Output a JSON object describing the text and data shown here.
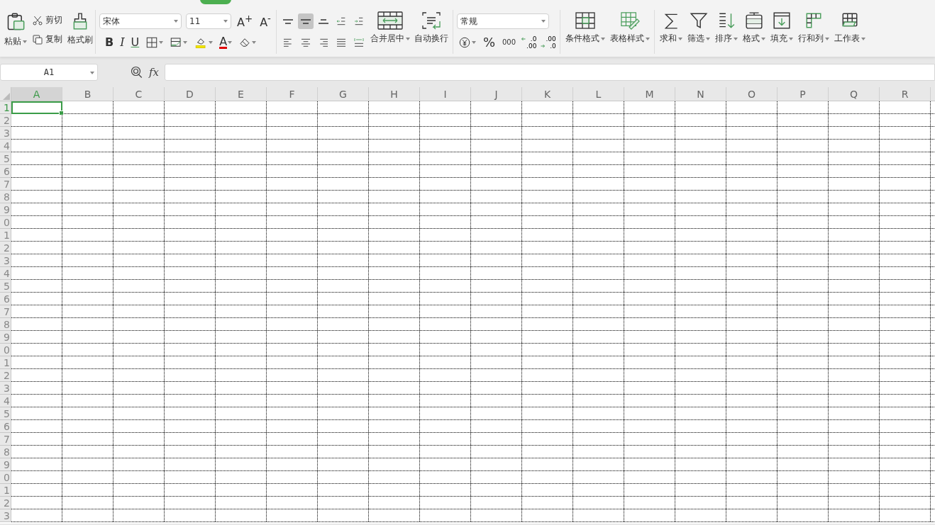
{
  "ribbon": {
    "groups": [
      {
        "kind": "clipboard",
        "paste": "粘贴",
        "cut": "剪切",
        "copy": "复制",
        "painter": "格式刷"
      },
      {
        "kind": "font",
        "font_name": "宋体",
        "font_size": "11",
        "grow": "A$^{+}$",
        "shrink": "A$^{-}$",
        "bold": "B",
        "italic": "I",
        "underline": "U",
        "font_color": "A"
      },
      {
        "kind": "alignment",
        "align_buttons": [
          {
            "selected": false
          },
          {
            "selected": true
          },
          {
            "selected": false
          },
          {
            "selected": false
          },
          {
            "selected": false
          },
          {
            "selected": false
          },
          {
            "selected": false
          },
          {
            "selected": false
          },
          {
            "selected": false
          },
          {
            "selected": false
          }
        ],
        "merge": "合并居中",
        "wrap": "自动换行"
      },
      {
        "kind": "number",
        "format": "常规",
        "percent": "%",
        "thousands": "000",
        "decimal_increase": [
          ".0",
          ".00"
        ],
        "decimal_decrease": [
          ".00",
          ".0"
        ]
      },
      {
        "kind": "large",
        "buttons": [
          {
            "label": "条件格式"
          },
          {
            "label": "表格样式"
          }
        ]
      },
      {
        "kind": "large",
        "buttons": [
          {
            "label": "求和"
          },
          {
            "label": "筛选"
          },
          {
            "label": "排序"
          },
          {
            "label": "格式"
          },
          {
            "label": "填充"
          },
          {
            "label": "行和列"
          },
          {
            "label": "工作表"
          }
        ]
      }
    ]
  },
  "formula_bar": {
    "name_box": "A1",
    "fx": "fx"
  },
  "sheet": {
    "columns": [
      {
        "label": "A",
        "selected": true
      },
      {
        "label": "B",
        "selected": false
      },
      {
        "label": "C",
        "selected": false
      },
      {
        "label": "D",
        "selected": false
      },
      {
        "label": "E",
        "selected": false
      },
      {
        "label": "F",
        "selected": false
      },
      {
        "label": "G",
        "selected": false
      },
      {
        "label": "H",
        "selected": false
      },
      {
        "label": "I",
        "selected": false
      },
      {
        "label": "J",
        "selected": false
      },
      {
        "label": "K",
        "selected": false
      },
      {
        "label": "L",
        "selected": false
      },
      {
        "label": "M",
        "selected": false
      },
      {
        "label": "N",
        "selected": false
      },
      {
        "label": "O",
        "selected": false
      },
      {
        "label": "P",
        "selected": false
      },
      {
        "label": "Q",
        "selected": false
      },
      {
        "label": "R",
        "selected": false
      }
    ],
    "rows": [
      {
        "label": "1",
        "selected": true
      },
      {
        "label": "2",
        "selected": false
      },
      {
        "label": "3",
        "selected": false
      },
      {
        "label": "4",
        "selected": false
      },
      {
        "label": "5",
        "selected": false
      },
      {
        "label": "6",
        "selected": false
      },
      {
        "label": "7",
        "selected": false
      },
      {
        "label": "8",
        "selected": false
      },
      {
        "label": "9",
        "selected": false
      },
      {
        "label": "0",
        "selected": false
      },
      {
        "label": "1",
        "selected": false
      },
      {
        "label": "2",
        "selected": false
      },
      {
        "label": "3",
        "selected": false
      },
      {
        "label": "4",
        "selected": false
      },
      {
        "label": "5",
        "selected": false
      },
      {
        "label": "6",
        "selected": false
      },
      {
        "label": "7",
        "selected": false
      },
      {
        "label": "8",
        "selected": false
      },
      {
        "label": "9",
        "selected": false
      },
      {
        "label": "0",
        "selected": false
      },
      {
        "label": "1",
        "selected": false
      },
      {
        "label": "2",
        "selected": false
      },
      {
        "label": "3",
        "selected": false
      },
      {
        "label": "4",
        "selected": false
      },
      {
        "label": "5",
        "selected": false
      },
      {
        "label": "6",
        "selected": false
      },
      {
        "label": "7",
        "selected": false
      },
      {
        "label": "8",
        "selected": false
      },
      {
        "label": "9",
        "selected": false
      },
      {
        "label": "0",
        "selected": false
      },
      {
        "label": "1",
        "selected": false
      },
      {
        "label": "2",
        "selected": false
      },
      {
        "label": "3",
        "selected": false
      }
    ]
  }
}
